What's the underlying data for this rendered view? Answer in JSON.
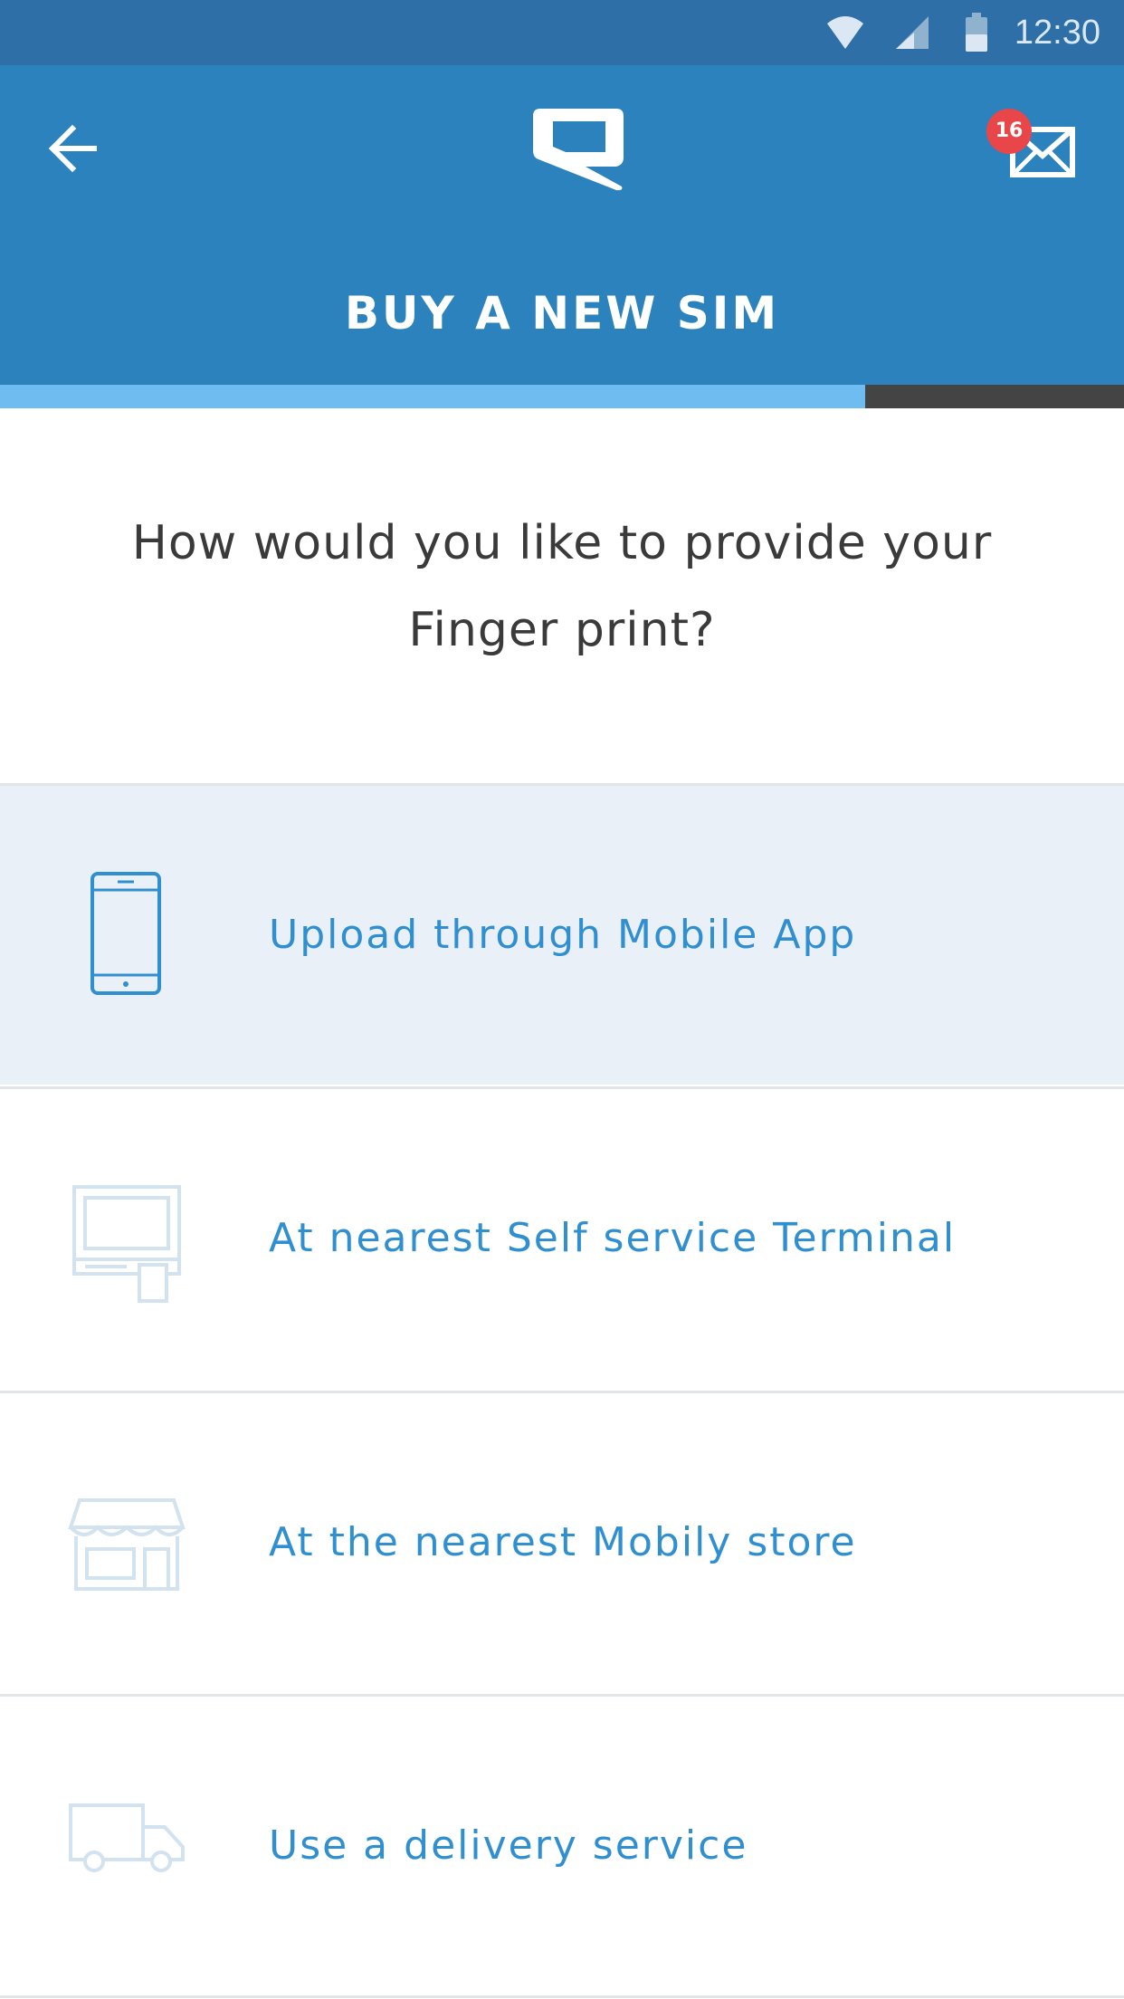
{
  "status_bar": {
    "time": "12:30",
    "icons": [
      "wifi-icon",
      "signal-icon",
      "battery-icon"
    ]
  },
  "header": {
    "back_icon": "arrow-left-icon",
    "logo_icon": "mobily-logo-icon",
    "inbox_icon": "envelope-icon",
    "inbox_badge": "16",
    "title": "BUY A NEW SIM",
    "progress_fraction": 0.77
  },
  "main": {
    "question": "How would you like to provide your Finger print?",
    "options": [
      {
        "label": "Upload through Mobile App",
        "icon": "smartphone-icon",
        "selected": true
      },
      {
        "label": "At nearest Self service Terminal",
        "icon": "kiosk-terminal-icon",
        "selected": false
      },
      {
        "label": "At the nearest Mobily store",
        "icon": "store-icon",
        "selected": false
      },
      {
        "label": "Use a delivery service",
        "icon": "delivery-truck-icon",
        "selected": false
      }
    ]
  },
  "colors": {
    "header": "#2b82bd",
    "status_bar": "#2d6fa6",
    "accent_text": "#2f8fd1",
    "progress_fill": "#6fbdf0",
    "progress_track": "#444444",
    "badge": "#e9464a",
    "selected_row": "#eaf0f7"
  }
}
